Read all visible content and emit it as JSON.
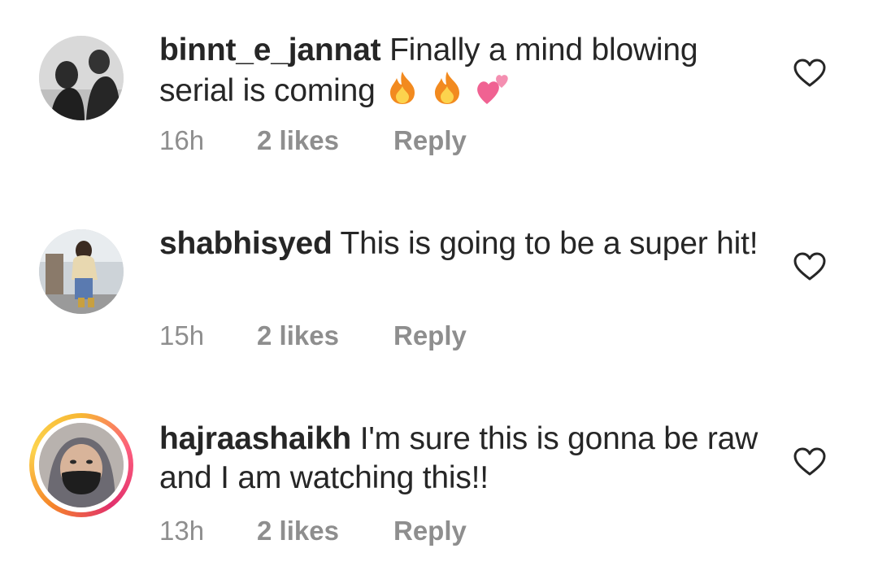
{
  "comments": [
    {
      "username": "binnt_e_jannat",
      "text": "Finally a mind blowing serial is coming",
      "emojis": [
        "fire-emoji",
        "fire-emoji",
        "two-hearts-emoji"
      ],
      "time": "16h",
      "likes": "2 likes",
      "reply": "Reply",
      "story_ring": false
    },
    {
      "username": "shabhisyed",
      "text": "This is going to be a super hit!",
      "time": "15h",
      "likes": "2 likes",
      "reply": "Reply",
      "story_ring": false
    },
    {
      "username": "hajraashaikh",
      "text": "I'm sure this is gonna be raw and I am watching this!!",
      "time": "13h",
      "likes": "2 likes",
      "reply": "Reply",
      "story_ring": true
    }
  ],
  "icons": {
    "like": "heart-outline-icon"
  },
  "colors": {
    "text": "#262626",
    "meta": "#8e8e8e",
    "story_ring": [
      "#f7b733",
      "#e1306c",
      "#f58529"
    ]
  }
}
